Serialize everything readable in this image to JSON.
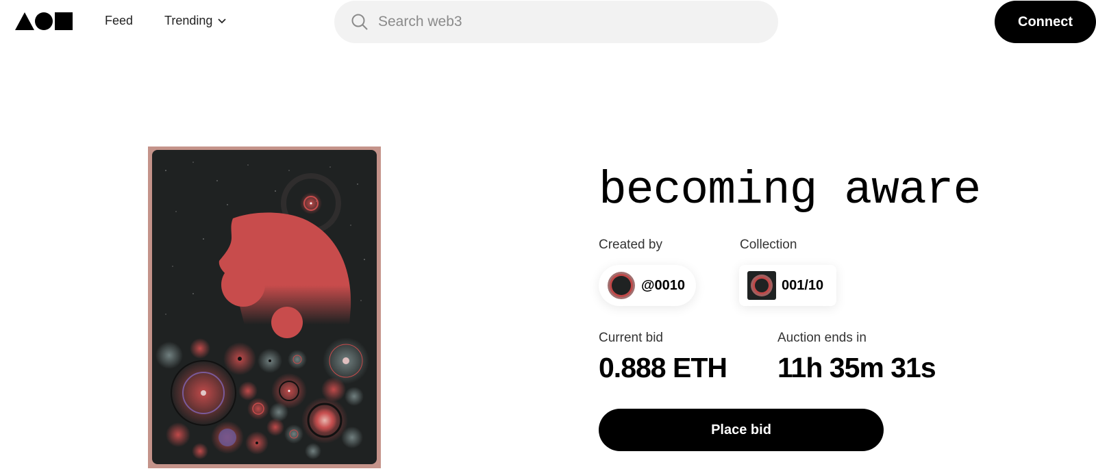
{
  "header": {
    "nav": {
      "feed": "Feed",
      "trending": "Trending"
    },
    "search": {
      "placeholder": "Search web3"
    },
    "connect_label": "Connect"
  },
  "icons": {
    "logo": "triangle-circle-square-logo",
    "search": "search-icon",
    "trending_caret": "chevron-down-icon"
  },
  "artwork": {
    "colors": {
      "frame": "#c4938a",
      "background": "#1f2222",
      "accent": "#c84c4c"
    }
  },
  "item": {
    "title": "becoming aware",
    "created_by_label": "Created by",
    "creator": "@0010",
    "collection_label": "Collection",
    "collection": "001/10",
    "current_bid_label": "Current bid",
    "current_bid": "0.888 ETH",
    "auction_ends_label": "Auction ends in",
    "auction_ends": "11h 35m 31s",
    "place_bid_label": "Place bid"
  },
  "colors": {
    "primary_button": "#000000",
    "search_bg": "#f2f2f2"
  }
}
